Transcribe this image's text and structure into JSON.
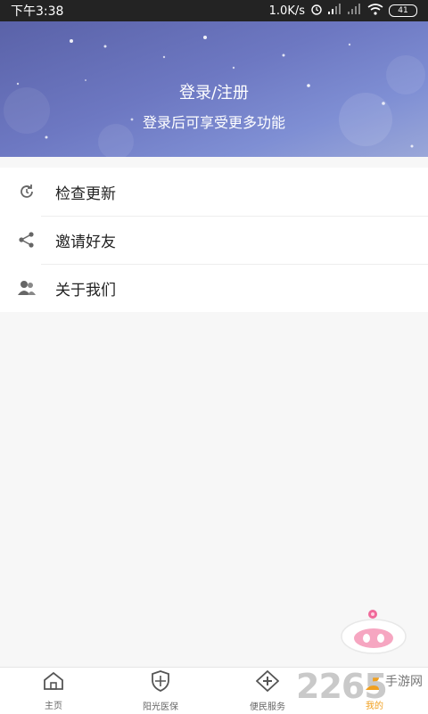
{
  "status_bar": {
    "time": "下午3:38",
    "speed": "1.0K/s",
    "battery": "41"
  },
  "header": {
    "login_title": "登录/注册",
    "login_subtitle": "登录后可享受更多功能"
  },
  "menu": {
    "items": [
      {
        "label": "检查更新",
        "icon": "refresh-icon"
      },
      {
        "label": "邀请好友",
        "icon": "share-icon"
      },
      {
        "label": "关于我们",
        "icon": "users-icon"
      }
    ]
  },
  "tabbar": {
    "tabs": [
      {
        "label": "主页",
        "icon": "home-icon"
      },
      {
        "label": "阳光医保",
        "icon": "shield-icon"
      },
      {
        "label": "便民服务",
        "icon": "plus-diamond-icon"
      },
      {
        "label": "我的",
        "icon": "user-icon",
        "active": true
      }
    ]
  },
  "watermark": {
    "number": "2265",
    "text": "手游网"
  },
  "colors": {
    "accent": "#f0a020",
    "header_start": "#5a62a8",
    "header_end": "#9aa7d8"
  }
}
